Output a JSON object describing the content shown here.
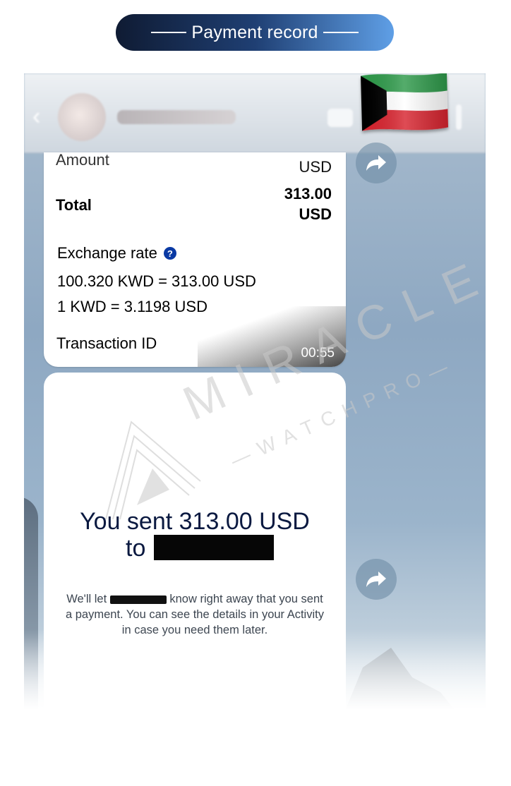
{
  "banner": {
    "title": "Payment record"
  },
  "card_top": {
    "amount_label": "Amount",
    "amount_currency": "USD",
    "total_label": "Total",
    "total_value": "313.00",
    "total_currency": "USD",
    "exchange_rate_label": "Exchange rate",
    "help_glyph": "?",
    "exchange_line_1": "100.320 KWD = 313.00 USD",
    "exchange_line_2": "1 KWD = 3.1198 USD",
    "transaction_id_label": "Transaction ID",
    "timestamp": "00:55"
  },
  "card_bottom": {
    "sent_line": "You sent 313.00 USD",
    "to_label": "to",
    "body_prefix": "We'll let",
    "body_suffix": "know right away that you sent a payment. You can see the details in your Activity in case you need them later."
  },
  "watermark": {
    "brand": "MIRACLE",
    "tagline": "—WATCHPRO—"
  },
  "icons": {
    "back": "chevron-left-icon",
    "forward": "share-arrow-icon",
    "flag": "kuwait-flag-icon",
    "help": "question-circle-icon"
  },
  "colors": {
    "banner_start": "#0f1b33",
    "banner_end": "#5f9fe6",
    "paypal_navy": "#0a1940",
    "help_blue": "#0a3aa4"
  }
}
